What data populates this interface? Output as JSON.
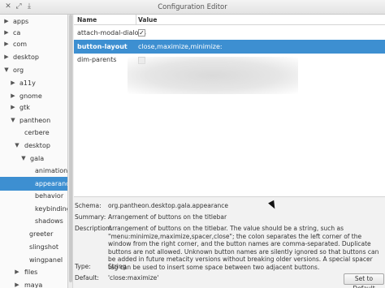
{
  "window": {
    "title": "Configuration Editor",
    "controls": [
      "close-icon",
      "maximize-icon",
      "minimize-icon"
    ]
  },
  "sidebar": {
    "items": [
      {
        "label": "apps",
        "state": "collapsed"
      },
      {
        "label": "ca",
        "state": "collapsed"
      },
      {
        "label": "com",
        "state": "collapsed"
      },
      {
        "label": "desktop",
        "state": "collapsed"
      },
      {
        "label": "org",
        "state": "expanded"
      },
      {
        "label": "a11y",
        "state": "collapsed"
      },
      {
        "label": "gnome",
        "state": "collapsed"
      },
      {
        "label": "gtk",
        "state": "collapsed"
      },
      {
        "label": "pantheon",
        "state": "expanded"
      },
      {
        "label": "cerbere",
        "state": "leaf"
      },
      {
        "label": "desktop",
        "state": "expanded"
      },
      {
        "label": "gala",
        "state": "expanded"
      },
      {
        "label": "animations",
        "state": "leaf"
      },
      {
        "label": "appearance",
        "state": "leaf",
        "selected": true
      },
      {
        "label": "behavior",
        "state": "leaf"
      },
      {
        "label": "keybindings",
        "state": "leaf"
      },
      {
        "label": "shadows",
        "state": "leaf"
      },
      {
        "label": "greeter",
        "state": "leaf"
      },
      {
        "label": "slingshot",
        "state": "leaf"
      },
      {
        "label": "wingpanel",
        "state": "leaf"
      },
      {
        "label": "files",
        "state": "collapsed"
      },
      {
        "label": "maya",
        "state": "collapsed"
      }
    ]
  },
  "table": {
    "headers": {
      "name": "Name",
      "value": "Value"
    },
    "rows": [
      {
        "name": "attach-modal-dialogs",
        "value": "",
        "type": "checkbox",
        "checked": true
      },
      {
        "name": "button-layout",
        "value": "close,maximize,minimize:",
        "type": "text",
        "selected": true
      },
      {
        "name": "dim-parents",
        "value": "",
        "type": "checkbox",
        "checked": false
      }
    ]
  },
  "details": {
    "schema_label": "Schema:",
    "schema_value": "org.pantheon.desktop.gala.appearance",
    "summary_label": "Summary:",
    "summary_value": "Arrangement of buttons on the titlebar",
    "description_label": "Description:",
    "description_value": "Arrangement of buttons on the titlebar. The value should be a string, such as \"menu:minimize,maximize,spacer,close\"; the colon separates the left corner of the window from the right corner, and the button names are comma-separated. Duplicate buttons are not allowed. Unknown button names are silently ignored so that buttons can be added in future metacity versions without breaking older versions. A special spacer tag can be used to insert some space between two adjacent buttons.",
    "type_label": "Type:",
    "type_value": "String",
    "default_label": "Default:",
    "default_value": "'close:maximize'",
    "set_default_button": "Set to Default"
  },
  "colors": {
    "selection": "#3d8fd1",
    "background": "#f2f2f2"
  }
}
